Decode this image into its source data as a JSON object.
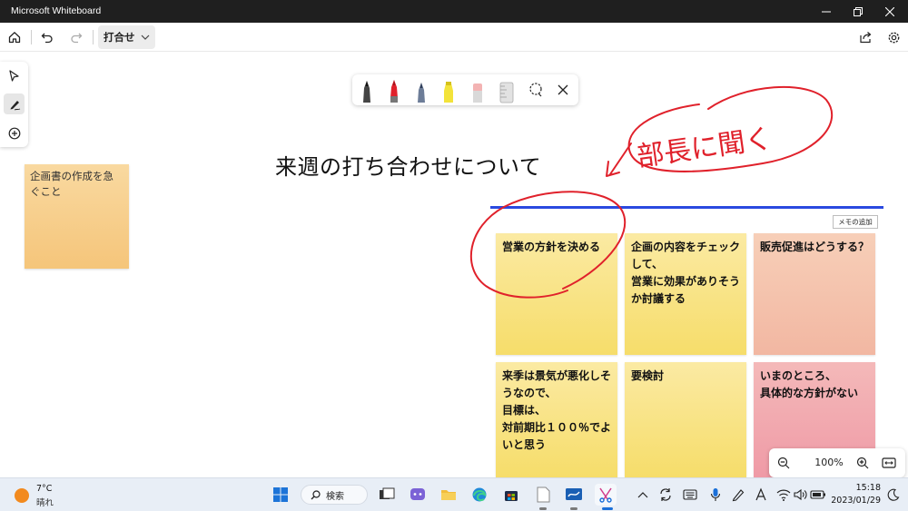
{
  "window": {
    "title": "Microsoft Whiteboard"
  },
  "toolbar": {
    "board_name": "打合せ"
  },
  "canvas": {
    "heading": "来週の打ち合わせについて",
    "left_note": "企画書の作成を急ぐこと",
    "add_memo_label": "メモの追加",
    "handwriting": "部長に聞く",
    "cards": [
      {
        "text": "営業の方針を決める",
        "color": "yellow"
      },
      {
        "text": "企画の内容をチェックして、\n営業に効果がありそうか討議する",
        "color": "yellow"
      },
      {
        "text": "販売促進はどうする？",
        "color": "salmon"
      },
      {
        "text": "来季は景気が悪化しそうなので、\n目標は、\n対前期比１００％でよいと思う",
        "color": "yellow"
      },
      {
        "text": "要検討",
        "color": "yellow"
      },
      {
        "text": "いまのところ、\n具体的な方針がない",
        "color": "pink"
      }
    ]
  },
  "pens": [
    {
      "name": "black-pen",
      "color": "#222222"
    },
    {
      "name": "red-pen",
      "color": "#e0212b"
    },
    {
      "name": "blue-pen",
      "color": "#3b4a6b"
    },
    {
      "name": "yellow-highlighter",
      "color": "#f3e33a"
    },
    {
      "name": "eraser",
      "color": "#f3b3b3"
    },
    {
      "name": "ruler",
      "color": "#c8c8c8"
    }
  ],
  "ink": {
    "color": "#e0212b",
    "underline_color": "#2a49e0"
  },
  "zoom": {
    "value": "100%"
  },
  "taskbar": {
    "weather_temp": "7°C",
    "weather_desc": "晴れ",
    "search_label": "検索",
    "time": "15:18",
    "date": "2023/01/29"
  }
}
